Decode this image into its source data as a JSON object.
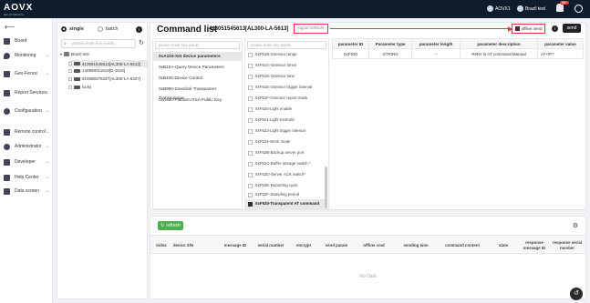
{
  "topbar": {
    "logo": "AOVX",
    "logo_sub": "Aim Of Valuation",
    "user": "AOVX1",
    "org": "Brazil test",
    "badge": "99+"
  },
  "sidebar": {
    "items": [
      {
        "label": "Board",
        "icon": "grid-icon"
      },
      {
        "label": "Monitoring",
        "icon": "location-icon"
      },
      {
        "label": "Geo-Fence",
        "icon": "map-icon"
      },
      {
        "label": "Report Services",
        "icon": "report-icon"
      },
      {
        "label": "Configuration",
        "icon": "gear-icon"
      },
      {
        "label": "Remote control",
        "icon": "remote-icon"
      },
      {
        "label": "Administrator",
        "icon": "user-icon"
      },
      {
        "label": "Developer",
        "icon": "folder-icon"
      },
      {
        "label": "Help Center",
        "icon": "headset-icon"
      },
      {
        "label": "Data screen",
        "icon": "monitor-icon"
      }
    ]
  },
  "tree": {
    "mode_single": "single",
    "mode_batch": "batch",
    "search_placeholder": "please enter key words",
    "root": "Brazil test",
    "devices": [
      "413051545613[AL300-LA-5613]",
      "140868011618[D-1618]",
      "810688375327[AL300-LA-5327]",
      "lucky"
    ]
  },
  "main": {
    "title": "Command list",
    "device": "413051545613[AL300-LA-5613]",
    "logout_label": "logout network",
    "offline_label": "offline send",
    "send_label": "send",
    "search_placeholder": "please enter key words",
    "commands": [
      "0xA103-Set device parameters",
      "0xB10A-Query Device Parameters",
      "0xB105-Device Control",
      "0xB900-Downlink Transparent Transmission",
      "0xA400-Platform RSA Public Key"
    ],
    "params": [
      "0xF51B-Gsensor range",
      "0xF51C-Gsensor times",
      "0xF51D-Gsensor time",
      "0xF51E-Gsensor trigger interval",
      "0xF51F-Gsensor report mask",
      "0xF520-Light enable",
      "0xF521-Light treshold",
      "0xF522-Light trigger interval",
      "0xF524-Work mode",
      "0xF52B-Backup server port",
      "0xF52C-Buffer storage switch *",
      "0xF52D-Server ACK switch*",
      "0xF52E-Reporting cycle",
      "0xF52F-Sampling period",
      "0xF530-Transparent AT command"
    ],
    "param_table": {
      "headers": [
        "parameter ID",
        "Parameter type",
        "parameter length",
        "parameter description",
        "parameter value"
      ],
      "row": [
        "0xF530",
        "STRING",
        "--",
        "Refer to AT command Manual",
        "AT+IP?"
      ]
    }
  },
  "bottom": {
    "refresh_label": "refresh",
    "columns": [
      "Index",
      "device S/N",
      "message ID",
      "serial number",
      "encrypt",
      "send param",
      "offline cmd",
      "sending time",
      "command content",
      "state",
      "response message ID",
      "response serial number"
    ],
    "empty": "No Data"
  }
}
